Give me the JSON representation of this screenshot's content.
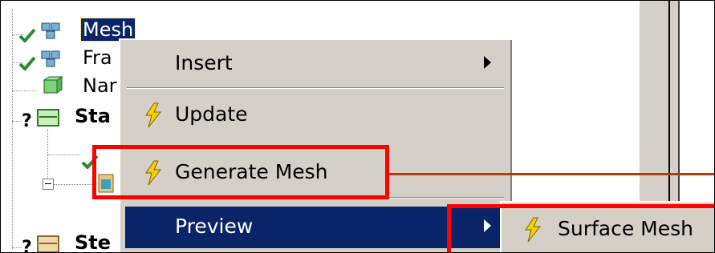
{
  "tree": {
    "items": [
      {
        "label": "Mesh",
        "icon": "mesh-icon"
      },
      {
        "label": "Fra",
        "icon": "fracture-icon"
      },
      {
        "label": "Nar",
        "icon": "named-selections-icon"
      },
      {
        "label": "Sta",
        "icon": "folder-icon"
      },
      {
        "label": "Ste",
        "icon": "folder-icon"
      }
    ],
    "question_mark": "?",
    "question_mark_2": "?"
  },
  "context_menu": {
    "items": [
      {
        "label": "Insert",
        "has_submenu": true,
        "icon": ""
      },
      {
        "label": "Update",
        "has_submenu": false,
        "icon": "lightning-bolt-icon"
      },
      {
        "label": "Generate Mesh",
        "has_submenu": false,
        "icon": "lightning-bolt-icon"
      },
      {
        "label": "Preview",
        "has_submenu": true,
        "icon": "",
        "highlighted": true
      }
    ]
  },
  "submenu": {
    "items": [
      {
        "label": "Surface Mesh",
        "icon": "lightning-bolt-icon"
      }
    ]
  },
  "colors": {
    "highlight": "#0a246a",
    "menu_bg": "#d4d0c8",
    "annotation": "#ff0000",
    "connector": "#b83a0a",
    "check": "#2a8a2a"
  }
}
